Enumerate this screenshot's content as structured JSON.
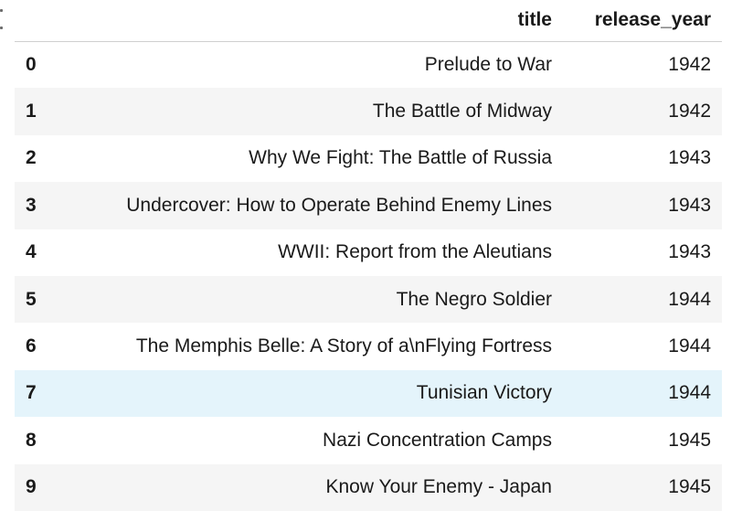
{
  "table": {
    "columns": [
      "",
      "title",
      "release_year"
    ],
    "rows": [
      {
        "index": "0",
        "title": "Prelude to War",
        "release_year": "1942"
      },
      {
        "index": "1",
        "title": "The Battle of Midway",
        "release_year": "1942"
      },
      {
        "index": "2",
        "title": "Why We Fight: The Battle of Russia",
        "release_year": "1943"
      },
      {
        "index": "3",
        "title": "Undercover: How to Operate Behind Enemy Lines",
        "release_year": "1943"
      },
      {
        "index": "4",
        "title": "WWII: Report from the Aleutians",
        "release_year": "1943"
      },
      {
        "index": "5",
        "title": "The Negro Soldier",
        "release_year": "1944"
      },
      {
        "index": "6",
        "title": "The Memphis Belle: A Story of a\\nFlying Fortress",
        "release_year": "1944"
      },
      {
        "index": "7",
        "title": "Tunisian Victory",
        "release_year": "1944"
      },
      {
        "index": "8",
        "title": "Nazi Concentration Camps",
        "release_year": "1945"
      },
      {
        "index": "9",
        "title": "Know Your Enemy - Japan",
        "release_year": "1945"
      }
    ],
    "highlighted_row": 7,
    "colors": {
      "header_border": "#cfcfcf",
      "stripe": "#f5f5f5",
      "hover": "#e4f4fb"
    }
  }
}
